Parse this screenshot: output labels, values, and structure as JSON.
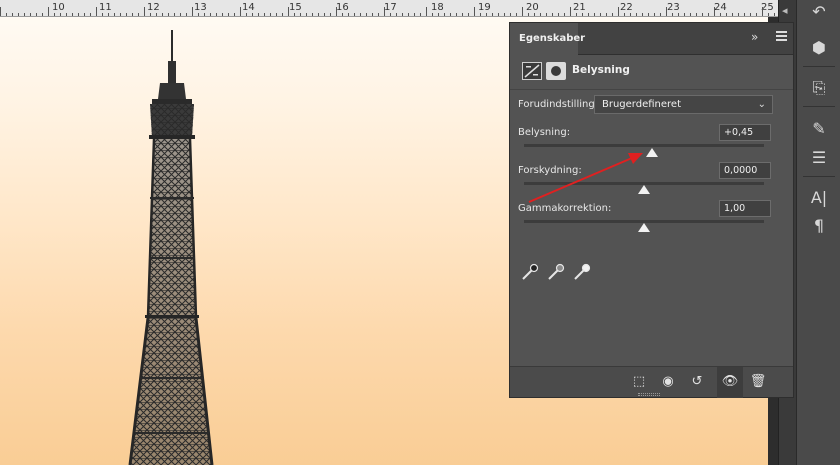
{
  "ruler": {
    "numbers": [
      "10",
      "11",
      "12",
      "13",
      "14",
      "15",
      "16",
      "17",
      "18",
      "19",
      "20",
      "21",
      "22",
      "23",
      "24",
      "25"
    ]
  },
  "panel": {
    "tab_label": "Egenskaber",
    "collapse_glyph": "»",
    "adjustment_title": "Belysning",
    "preset": {
      "label": "Forudindstilling:",
      "value": "Brugerdefineret"
    },
    "sliders": [
      {
        "label": "Belysning:",
        "value": "+0,45"
      },
      {
        "label": "Forskydning:",
        "value": "0,0000"
      },
      {
        "label": "Gammakorrektion:",
        "value": "1,00"
      }
    ]
  },
  "icons": {
    "dock": [
      "3d-icon",
      "clone-source-icon",
      "brush-presets-icon",
      "adjustments-icon",
      "character-icon",
      "paragraph-icon"
    ],
    "pickers": [
      "black-eyedropper-icon",
      "gray-eyedropper-icon",
      "white-eyedropper-icon"
    ],
    "footer": [
      "clip-to-layer-icon",
      "view-previous-state-icon",
      "reset-icon",
      "visibility-icon",
      "delete-icon"
    ]
  },
  "colors": {
    "annotation_arrow": "#e02020",
    "panel_bg": "#535353"
  }
}
